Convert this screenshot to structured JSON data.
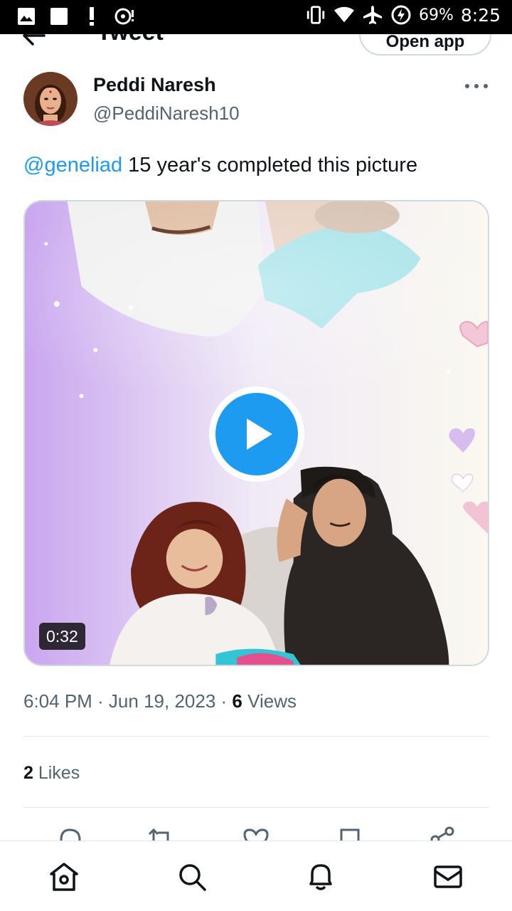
{
  "status_bar": {
    "battery": "69%",
    "time": "8:25"
  },
  "header": {
    "title": "Tweet",
    "open_app": "Open app"
  },
  "tweet": {
    "author_name": "Peddi Naresh",
    "author_handle": "@PeddiNaresh10",
    "mention": "@geneliad",
    "text": " 15 year's completed this picture",
    "video_duration": "0:32",
    "timestamp": "6:04 PM · Jun 19, 2023 · ",
    "views_count": "6",
    "views_label": " Views",
    "likes_count": "2",
    "likes_label": " Likes"
  },
  "icons": {
    "status_left": [
      "gallery-icon",
      "square-notification-icon",
      "alert-icon",
      "media-cast-icon"
    ],
    "status_right": [
      "vibrate-icon",
      "wifi-icon",
      "airplane-icon",
      "battery-charging-icon"
    ],
    "actions": [
      "reply-icon",
      "retweet-icon",
      "like-icon",
      "bookmark-icon",
      "share-icon"
    ],
    "nav": [
      "home-icon",
      "search-icon",
      "notifications-icon",
      "messages-icon"
    ]
  },
  "colors": {
    "accent": "#1d9bf0",
    "text_primary": "#0f1419",
    "text_secondary": "#536471",
    "border": "#cfd9de"
  }
}
